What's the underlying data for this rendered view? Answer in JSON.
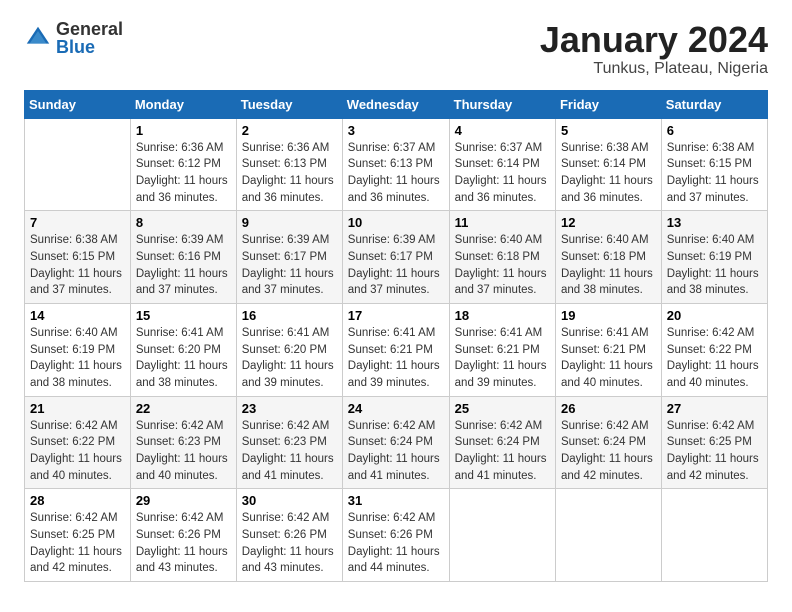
{
  "logo": {
    "general": "General",
    "blue": "Blue"
  },
  "title": "January 2024",
  "subtitle": "Tunkus, Plateau, Nigeria",
  "weekdays": [
    "Sunday",
    "Monday",
    "Tuesday",
    "Wednesday",
    "Thursday",
    "Friday",
    "Saturday"
  ],
  "weeks": [
    [
      {
        "day": "",
        "sunrise": "",
        "sunset": "",
        "daylight": ""
      },
      {
        "day": "1",
        "sunrise": "Sunrise: 6:36 AM",
        "sunset": "Sunset: 6:12 PM",
        "daylight": "Daylight: 11 hours and 36 minutes."
      },
      {
        "day": "2",
        "sunrise": "Sunrise: 6:36 AM",
        "sunset": "Sunset: 6:13 PM",
        "daylight": "Daylight: 11 hours and 36 minutes."
      },
      {
        "day": "3",
        "sunrise": "Sunrise: 6:37 AM",
        "sunset": "Sunset: 6:13 PM",
        "daylight": "Daylight: 11 hours and 36 minutes."
      },
      {
        "day": "4",
        "sunrise": "Sunrise: 6:37 AM",
        "sunset": "Sunset: 6:14 PM",
        "daylight": "Daylight: 11 hours and 36 minutes."
      },
      {
        "day": "5",
        "sunrise": "Sunrise: 6:38 AM",
        "sunset": "Sunset: 6:14 PM",
        "daylight": "Daylight: 11 hours and 36 minutes."
      },
      {
        "day": "6",
        "sunrise": "Sunrise: 6:38 AM",
        "sunset": "Sunset: 6:15 PM",
        "daylight": "Daylight: 11 hours and 37 minutes."
      }
    ],
    [
      {
        "day": "7",
        "sunrise": "Sunrise: 6:38 AM",
        "sunset": "Sunset: 6:15 PM",
        "daylight": "Daylight: 11 hours and 37 minutes."
      },
      {
        "day": "8",
        "sunrise": "Sunrise: 6:39 AM",
        "sunset": "Sunset: 6:16 PM",
        "daylight": "Daylight: 11 hours and 37 minutes."
      },
      {
        "day": "9",
        "sunrise": "Sunrise: 6:39 AM",
        "sunset": "Sunset: 6:17 PM",
        "daylight": "Daylight: 11 hours and 37 minutes."
      },
      {
        "day": "10",
        "sunrise": "Sunrise: 6:39 AM",
        "sunset": "Sunset: 6:17 PM",
        "daylight": "Daylight: 11 hours and 37 minutes."
      },
      {
        "day": "11",
        "sunrise": "Sunrise: 6:40 AM",
        "sunset": "Sunset: 6:18 PM",
        "daylight": "Daylight: 11 hours and 37 minutes."
      },
      {
        "day": "12",
        "sunrise": "Sunrise: 6:40 AM",
        "sunset": "Sunset: 6:18 PM",
        "daylight": "Daylight: 11 hours and 38 minutes."
      },
      {
        "day": "13",
        "sunrise": "Sunrise: 6:40 AM",
        "sunset": "Sunset: 6:19 PM",
        "daylight": "Daylight: 11 hours and 38 minutes."
      }
    ],
    [
      {
        "day": "14",
        "sunrise": "Sunrise: 6:40 AM",
        "sunset": "Sunset: 6:19 PM",
        "daylight": "Daylight: 11 hours and 38 minutes."
      },
      {
        "day": "15",
        "sunrise": "Sunrise: 6:41 AM",
        "sunset": "Sunset: 6:20 PM",
        "daylight": "Daylight: 11 hours and 38 minutes."
      },
      {
        "day": "16",
        "sunrise": "Sunrise: 6:41 AM",
        "sunset": "Sunset: 6:20 PM",
        "daylight": "Daylight: 11 hours and 39 minutes."
      },
      {
        "day": "17",
        "sunrise": "Sunrise: 6:41 AM",
        "sunset": "Sunset: 6:21 PM",
        "daylight": "Daylight: 11 hours and 39 minutes."
      },
      {
        "day": "18",
        "sunrise": "Sunrise: 6:41 AM",
        "sunset": "Sunset: 6:21 PM",
        "daylight": "Daylight: 11 hours and 39 minutes."
      },
      {
        "day": "19",
        "sunrise": "Sunrise: 6:41 AM",
        "sunset": "Sunset: 6:21 PM",
        "daylight": "Daylight: 11 hours and 40 minutes."
      },
      {
        "day": "20",
        "sunrise": "Sunrise: 6:42 AM",
        "sunset": "Sunset: 6:22 PM",
        "daylight": "Daylight: 11 hours and 40 minutes."
      }
    ],
    [
      {
        "day": "21",
        "sunrise": "Sunrise: 6:42 AM",
        "sunset": "Sunset: 6:22 PM",
        "daylight": "Daylight: 11 hours and 40 minutes."
      },
      {
        "day": "22",
        "sunrise": "Sunrise: 6:42 AM",
        "sunset": "Sunset: 6:23 PM",
        "daylight": "Daylight: 11 hours and 40 minutes."
      },
      {
        "day": "23",
        "sunrise": "Sunrise: 6:42 AM",
        "sunset": "Sunset: 6:23 PM",
        "daylight": "Daylight: 11 hours and 41 minutes."
      },
      {
        "day": "24",
        "sunrise": "Sunrise: 6:42 AM",
        "sunset": "Sunset: 6:24 PM",
        "daylight": "Daylight: 11 hours and 41 minutes."
      },
      {
        "day": "25",
        "sunrise": "Sunrise: 6:42 AM",
        "sunset": "Sunset: 6:24 PM",
        "daylight": "Daylight: 11 hours and 41 minutes."
      },
      {
        "day": "26",
        "sunrise": "Sunrise: 6:42 AM",
        "sunset": "Sunset: 6:24 PM",
        "daylight": "Daylight: 11 hours and 42 minutes."
      },
      {
        "day": "27",
        "sunrise": "Sunrise: 6:42 AM",
        "sunset": "Sunset: 6:25 PM",
        "daylight": "Daylight: 11 hours and 42 minutes."
      }
    ],
    [
      {
        "day": "28",
        "sunrise": "Sunrise: 6:42 AM",
        "sunset": "Sunset: 6:25 PM",
        "daylight": "Daylight: 11 hours and 42 minutes."
      },
      {
        "day": "29",
        "sunrise": "Sunrise: 6:42 AM",
        "sunset": "Sunset: 6:26 PM",
        "daylight": "Daylight: 11 hours and 43 minutes."
      },
      {
        "day": "30",
        "sunrise": "Sunrise: 6:42 AM",
        "sunset": "Sunset: 6:26 PM",
        "daylight": "Daylight: 11 hours and 43 minutes."
      },
      {
        "day": "31",
        "sunrise": "Sunrise: 6:42 AM",
        "sunset": "Sunset: 6:26 PM",
        "daylight": "Daylight: 11 hours and 44 minutes."
      },
      {
        "day": "",
        "sunrise": "",
        "sunset": "",
        "daylight": ""
      },
      {
        "day": "",
        "sunrise": "",
        "sunset": "",
        "daylight": ""
      },
      {
        "day": "",
        "sunrise": "",
        "sunset": "",
        "daylight": ""
      }
    ]
  ]
}
